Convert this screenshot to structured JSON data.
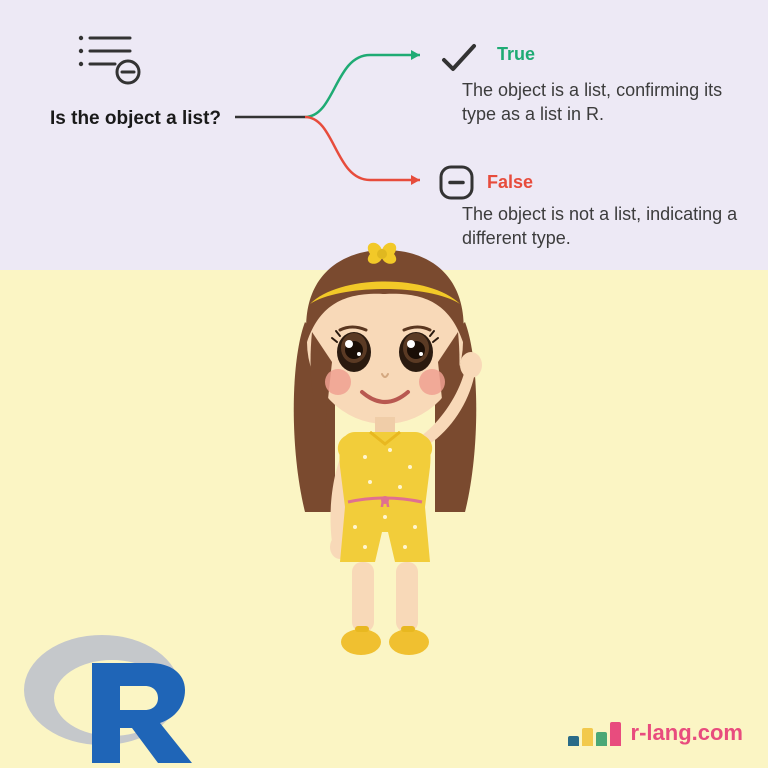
{
  "question": "Is the object a list?",
  "branches": {
    "true": {
      "label": "True",
      "description": "The object is a list, confirming its type as a list in R.",
      "color": "#1fab74"
    },
    "false": {
      "label": "False",
      "description": "The object is not a list, indicating a different type.",
      "color": "#e74c3c"
    }
  },
  "brand": {
    "text": "r-lang.com",
    "bars": [
      {
        "color": "#2a6b88",
        "height": 10
      },
      {
        "color": "#f2c94c",
        "height": 18
      },
      {
        "color": "#4aa876",
        "height": 14
      },
      {
        "color": "#e84c7e",
        "height": 24
      }
    ]
  },
  "colors": {
    "topBg": "#ede9f5",
    "bottomBg": "#fbf5c4",
    "trueGreen": "#1fab74",
    "falseRed": "#e74c3c",
    "brandPink": "#e84c7e",
    "rLogoBlue": "#1f65b7",
    "rLogoGray": "#9fa3a7"
  },
  "icons": {
    "listRemove": "list-remove-icon",
    "check": "check-icon",
    "minus": "minus-icon",
    "rLogo": "r-logo"
  }
}
